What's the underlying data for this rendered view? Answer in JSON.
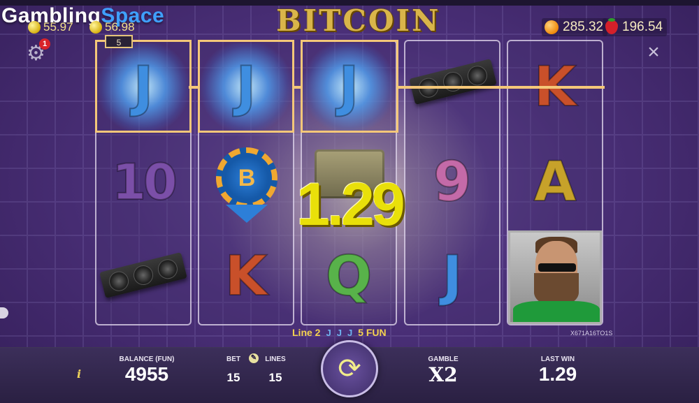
{
  "brand": {
    "part1": "Gambling",
    "part2": "Space"
  },
  "game_title": "BITCOIN",
  "top_left": {
    "coin_value_1": "55.97",
    "coin_value_2": "56.98",
    "line_badge": "5"
  },
  "top_right": {
    "orange_value": "285.32",
    "strawberry_value": "196.54"
  },
  "settings": {
    "badge_count": "1"
  },
  "icons": {
    "close": "×",
    "gear": "⚙",
    "spin": "⟳",
    "info": "i",
    "edit": "✎"
  },
  "reels": [
    [
      "J",
      "10",
      "GPU"
    ],
    [
      "J",
      "BTC",
      "K"
    ],
    [
      "J",
      "MINER",
      "Q"
    ],
    [
      "GPU",
      "9",
      "J"
    ],
    [
      "K",
      "A",
      "PORTRAIT"
    ]
  ],
  "btc_symbol": "B",
  "big_win": "1.29",
  "win_line": {
    "label": "Line 2",
    "symbols": [
      "J",
      "J",
      "J"
    ],
    "amount": "5 FUN"
  },
  "build_code": "X671A16TO1S",
  "bottom": {
    "balance_label": "BALANCE (FUN)",
    "balance_value": "4955",
    "bet_label": "BET",
    "bet_value": "15",
    "lines_label": "LINES",
    "lines_value": "15",
    "gamble_label": "GAMBLE",
    "gamble_value": "X2",
    "last_win_label": "LAST WIN",
    "last_win_value": "1.29"
  },
  "colors": {
    "jack_blue": "#3f8ee0",
    "ten_purple": "#7b4fa8",
    "k_red": "#c9502a",
    "q_green": "#58b24a",
    "nine_pink": "#c46aa8",
    "a_gold": "#c7a22a",
    "win_yellow": "#e9e00a",
    "payline": "#f4c779"
  }
}
